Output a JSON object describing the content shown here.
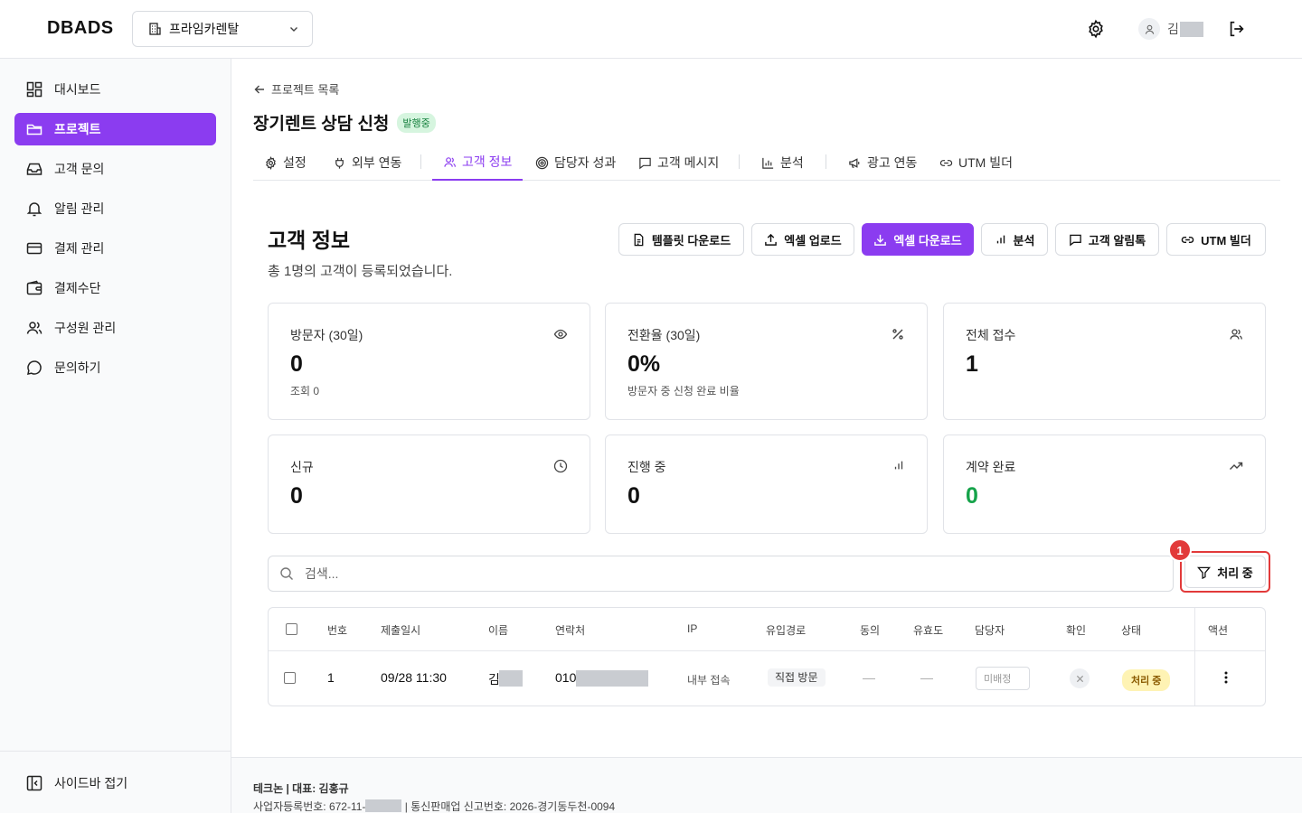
{
  "header": {
    "logo": "DBADS",
    "org": "프라임카렌탈",
    "user_initial": "김"
  },
  "sidebar": {
    "items": [
      {
        "label": "대시보드",
        "icon": "dashboard-icon"
      },
      {
        "label": "프로젝트",
        "icon": "folder-icon",
        "active": true
      },
      {
        "label": "고객 문의",
        "icon": "inbox-icon"
      },
      {
        "label": "알림 관리",
        "icon": "bell-icon"
      },
      {
        "label": "결제 관리",
        "icon": "credit-card-icon"
      },
      {
        "label": "결제수단",
        "icon": "wallet-icon"
      },
      {
        "label": "구성원 관리",
        "icon": "users-icon"
      },
      {
        "label": "문의하기",
        "icon": "chat-icon"
      }
    ],
    "collapse": "사이드바 접기"
  },
  "breadcrumb": "프로젝트 목록",
  "project": {
    "title": "장기렌트 상담 신청",
    "status": "발행중"
  },
  "tabs": [
    "설정",
    "외부 연동",
    "고객 정보",
    "담당자 성과",
    "고객 메시지",
    "분석",
    "광고 연동",
    "UTM 빌더"
  ],
  "section": {
    "title": "고객 정보",
    "subtitle": "총 1명의 고객이 등록되었습니다."
  },
  "actions": [
    "템플릿 다운로드",
    "엑셀 업로드",
    "엑셀 다운로드",
    "분석",
    "고객 알림톡",
    "UTM 빌더"
  ],
  "stats": [
    {
      "label": "방문자 (30일)",
      "value": "0",
      "sub": "조회 0",
      "icon": "eye-icon"
    },
    {
      "label": "전환율 (30일)",
      "value": "0%",
      "sub": "방문자 중 신청 완료 비율",
      "icon": "percent-icon"
    },
    {
      "label": "전체 접수",
      "value": "1",
      "sub": "",
      "icon": "users-icon"
    },
    {
      "label": "신규",
      "value": "0",
      "sub": "",
      "icon": "clock-icon"
    },
    {
      "label": "진행 중",
      "value": "0",
      "sub": "",
      "icon": "bar-chart-icon"
    },
    {
      "label": "계약 완료",
      "value": "0",
      "sub": "",
      "icon": "trending-up-icon"
    }
  ],
  "search": {
    "placeholder": "검색..."
  },
  "filter": {
    "label": "처리 중",
    "marker": "1"
  },
  "table": {
    "columns": [
      "번호",
      "제출일시",
      "이름",
      "연락처",
      "IP",
      "유입경로",
      "동의",
      "유효도",
      "담당자",
      "확인",
      "상태",
      "액션"
    ],
    "rows": [
      {
        "no": "1",
        "date": "09/28 11:30",
        "name": "김",
        "phone": "010",
        "ip": "내부 접속",
        "source": "직접 방문",
        "consent": "—",
        "validity": "—",
        "assignee": "미배정",
        "status": "처리 중"
      }
    ]
  },
  "footer": {
    "line1": "테크논 | 대표: 김홍규",
    "line2_prefix": "사업자등록번호: 672-11-",
    "line2_suffix": " | 통신판매업 신고번호: 2026-경기동두천-0094"
  },
  "colors": {
    "accent": "#8b3cf0",
    "success": "#16a34a",
    "highlight": "#e23a3a"
  }
}
